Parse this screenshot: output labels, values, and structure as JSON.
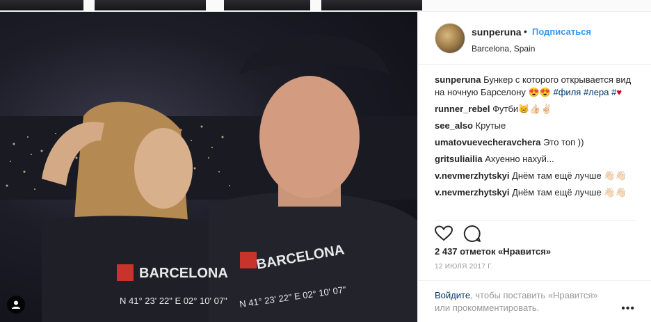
{
  "post": {
    "username": "sunperuna",
    "follow_dot": "•",
    "follow_label": "Подписаться",
    "location": "Barcelona, Spain",
    "shirt_text": "BARCELONA",
    "shirt_coords": "N 41° 23' 22\" E 02° 10' 07\""
  },
  "caption": {
    "user": "sunperuna",
    "text": "Бункер с которого открывается вид на ночную Барселону 😍😍",
    "hashtags": [
      "#филя",
      "#лера",
      "#"
    ],
    "heart": "♥"
  },
  "comments": [
    {
      "user": "runner_rebel",
      "text": "Футби😸👍🏻✌🏻"
    },
    {
      "user": "see_also",
      "text": "Крутые"
    },
    {
      "user": "umatovuevecheravchera",
      "text": "Это топ ))"
    },
    {
      "user": "gritsuliailia",
      "text": "Ахуенно нахуй..."
    },
    {
      "user": "v.nevmerzhytskyi",
      "text": "Днём там ещё лучше 👋🏻👋🏻"
    },
    {
      "user": "v.nevmerzhytskyi",
      "text": "Днём там ещё лучше 👋🏻👋🏻"
    }
  ],
  "actions": {
    "like_icon": "heart-outline-icon",
    "comment_icon": "speech-bubble-icon"
  },
  "likes_text": "2 437 отметок «Нравится»",
  "date_text": "12 ИЮЛЯ 2017 Г.",
  "login": {
    "link": "Войдите",
    "text1": ", чтобы поставить «Нравится»",
    "text2": "или прокомментировать."
  },
  "more_label": "•••"
}
